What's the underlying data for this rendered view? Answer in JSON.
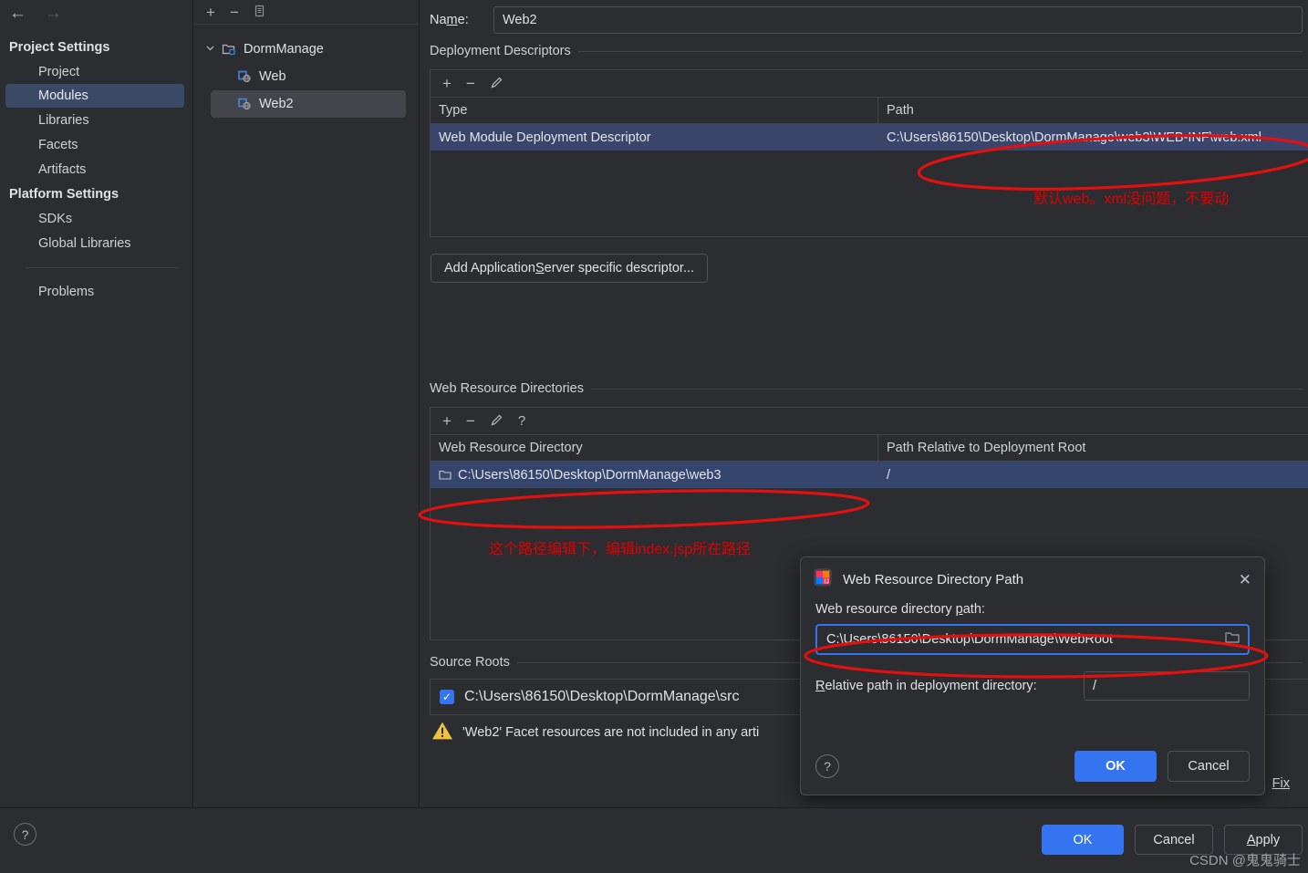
{
  "sidebar": {
    "back_arrow": "←",
    "forward_arrow": "→",
    "groups": [
      {
        "header": "Project Settings",
        "items": [
          "Project",
          "Modules",
          "Libraries",
          "Facets",
          "Artifacts"
        ]
      },
      {
        "header": "Platform Settings",
        "items": [
          "SDKs",
          "Global Libraries"
        ]
      }
    ],
    "problems_label": "Problems",
    "selected_item": "Modules"
  },
  "tree": {
    "toolbar": {
      "add": "+",
      "remove": "−",
      "copy": "☷"
    },
    "root": "DormManage",
    "children": [
      "Web",
      "Web2"
    ],
    "selected": "Web2"
  },
  "main": {
    "name_label": "Name:",
    "name_value": "Web2",
    "deployment": {
      "section_title": "Deployment Descriptors",
      "toolbar": {
        "add": "+",
        "remove": "−",
        "edit": "✎"
      },
      "columns": [
        "Type",
        "Path"
      ],
      "rows": [
        {
          "type": "Web Module Deployment Descriptor",
          "path": "C:\\Users\\86150\\Desktop\\DormManage\\web3\\WEB-INF\\web.xml"
        }
      ],
      "add_descriptor_button": "Add Application Server specific descriptor..."
    },
    "web_resources": {
      "section_title": "Web Resource Directories",
      "toolbar": {
        "add": "+",
        "remove": "−",
        "edit": "✎",
        "help": "?"
      },
      "columns": [
        "Web Resource Directory",
        "Path Relative to Deployment Root"
      ],
      "rows": [
        {
          "directory": "C:\\Users\\86150\\Desktop\\DormManage\\web3",
          "relative": "/"
        }
      ]
    },
    "source_roots": {
      "section_title": "Source Roots",
      "rows": [
        {
          "checked": true,
          "path": "C:\\Users\\86150\\Desktop\\DormManage\\src"
        }
      ]
    },
    "warning": {
      "icon": "warning-triangle",
      "text": "'Web2' Facet resources are not included in any arti",
      "fix_link": "Fix"
    }
  },
  "dialog": {
    "title": "Web Resource Directory Path",
    "close": "✕",
    "path_label": "Web resource directory path:",
    "path_value": "C:\\Users\\86150\\Desktop\\DormManage\\WebRoot",
    "browse_icon": "folder-icon",
    "relative_label": "Relative path in deployment directory:",
    "relative_value": "/",
    "help": "?",
    "ok": "OK",
    "cancel": "Cancel"
  },
  "bottom_bar": {
    "help": "?",
    "ok": "OK",
    "cancel": "Cancel",
    "apply": "Apply"
  },
  "annotations": [
    {
      "id": "anno_web_xml",
      "text": "默认web。xml没问题，不要动"
    },
    {
      "id": "anno_path_edit",
      "text": "这个路径编辑下，编辑index.jsp所在路径"
    }
  ],
  "colors": {
    "accent_blue": "#3574f0",
    "selection_blue": "#39456b",
    "annotation_red": "#e31010",
    "warning_yellow": "#f0c040",
    "background": "#2b2d30"
  },
  "watermark": "CSDN @鬼鬼骑士"
}
